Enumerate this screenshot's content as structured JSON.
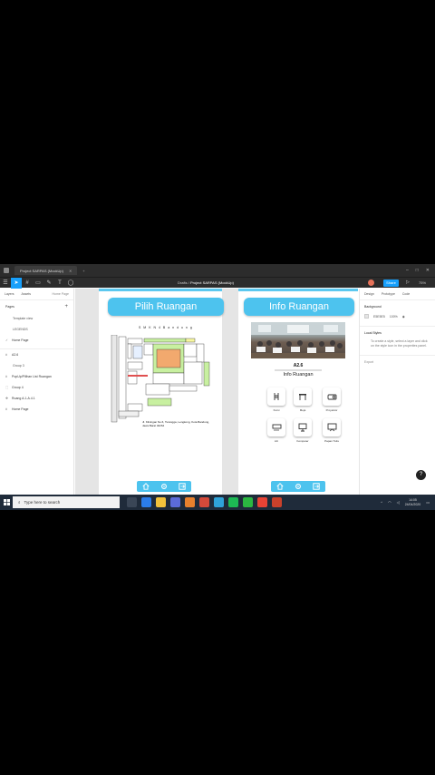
{
  "window": {
    "tab_title": "Project SARPAS (MockUp)",
    "breadcrumb_drafts": "Drafts",
    "breadcrumb_project": "Project SARPAS (MockUp)",
    "share_label": "Share",
    "zoom": "75%"
  },
  "left_panel": {
    "tabs": [
      "Layers",
      "Assets"
    ],
    "page_selector": "Home Page",
    "pages_label": "Pages",
    "pages": [
      "Template view",
      "LEGENDS",
      "Home Page"
    ],
    "layers": [
      "A2.6",
      "Group 3",
      "PopUp/Pilihan List Ruangan",
      "Group 4",
      "Ruang A.1-A.4.1",
      "Home Page"
    ]
  },
  "frames": {
    "pilih": {
      "title": "Pilih Ruangan",
      "school": "S M K N 4 B a n d u n g",
      "address": "Jl. Kliningan No.6, Turangga, Lengkong, Kota Bandung, Jawa Barat 40264"
    },
    "info": {
      "title": "Info Ruangan",
      "room_code": "A2.6",
      "room_title": "Info Ruangan",
      "facilities": [
        "Kursi",
        "Meja",
        "Proyektor",
        "AC",
        "Komputer",
        "Papan Tulis"
      ]
    }
  },
  "right_panel": {
    "tabs": [
      "Design",
      "Prototype",
      "Code"
    ],
    "background_label": "Background",
    "background_hex": "E5E5E5",
    "background_opacity": "100%",
    "local_styles_label": "Local Styles",
    "local_styles_hint": "To create a style, select a layer and click on the style icon in the properties panel.",
    "export_label": "Export",
    "help": "?"
  },
  "taskbar": {
    "search_placeholder": "Type here to search",
    "time": "14:05",
    "date": "24/04/2020"
  },
  "colors": {
    "accent": "#4dc3ee",
    "figma_blue": "#18a0fb",
    "canvas_bg": "#e5e5e5"
  }
}
